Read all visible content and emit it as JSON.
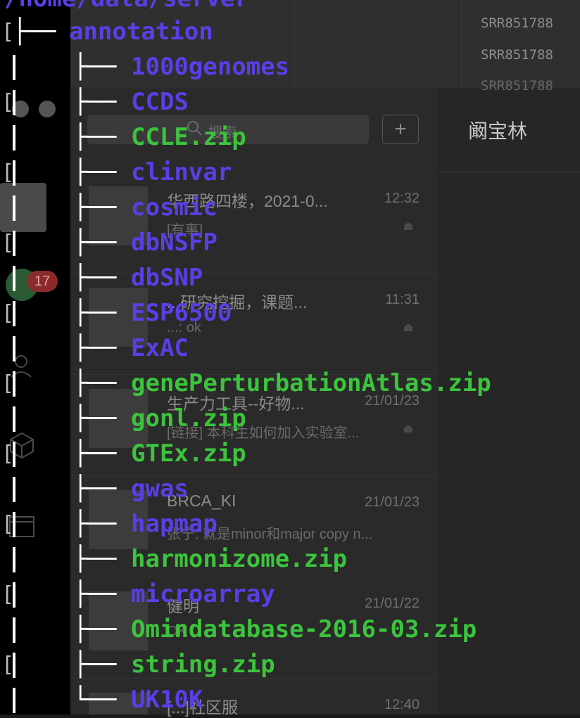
{
  "terminal": {
    "path": "/home/data/server",
    "root": "annotation",
    "entries": [
      {
        "name": "1000genomes",
        "kind": "dir"
      },
      {
        "name": "CCDS",
        "kind": "dir"
      },
      {
        "name": "CCLE.zip",
        "kind": "file"
      },
      {
        "name": "clinvar",
        "kind": "dir"
      },
      {
        "name": "cosmic",
        "kind": "dir"
      },
      {
        "name": "dbNSFP",
        "kind": "dir"
      },
      {
        "name": "dbSNP",
        "kind": "dir"
      },
      {
        "name": "ESP6500",
        "kind": "dir"
      },
      {
        "name": "ExAC",
        "kind": "dir"
      },
      {
        "name": "genePerturbationAtlas.zip",
        "kind": "file"
      },
      {
        "name": "gonl.zip",
        "kind": "file"
      },
      {
        "name": "GTEx.zip",
        "kind": "file"
      },
      {
        "name": "gwas",
        "kind": "dir"
      },
      {
        "name": "hapmap",
        "kind": "dir"
      },
      {
        "name": "harmonizome.zip",
        "kind": "file"
      },
      {
        "name": "microarray",
        "kind": "dir"
      },
      {
        "name": "Omindatabase-2016-03.zip",
        "kind": "file"
      },
      {
        "name": "string.zip",
        "kind": "file"
      },
      {
        "name": "UK10K",
        "kind": "dir"
      }
    ],
    "branch_glyph": "├──",
    "last_branch_glyph": "└──",
    "colors": {
      "dir": "#5a3fe6",
      "file": "#3cc43c",
      "tree": "#ffffff"
    }
  },
  "background": {
    "srr_lines": [
      "SRR851788",
      "SRR851788",
      "SRR851788"
    ],
    "search_placeholder": "搜索",
    "contact_name": "阚宝林",
    "unread_badge": "17",
    "chats": [
      {
        "title": "华西路四楼，2021-0...",
        "time": "12:32",
        "preview": "[有事]"
      },
      {
        "title": "...研究挖掘，课题...",
        "time": "11:31",
        "preview": "...: ok"
      },
      {
        "title": "生产力工具--好物...",
        "time": "21/01/23",
        "preview": "[链接] 本科生如何加入实验室..."
      },
      {
        "title": "BRCA_KI",
        "time": "21/01/23",
        "preview": "张宁: 就是minor和major copy n..."
      },
      {
        "title": "健明",
        "time": "21/01/22",
        "preview": "OK"
      },
      {
        "title": "[...]社区服",
        "time": "12:40",
        "preview": ""
      }
    ]
  }
}
